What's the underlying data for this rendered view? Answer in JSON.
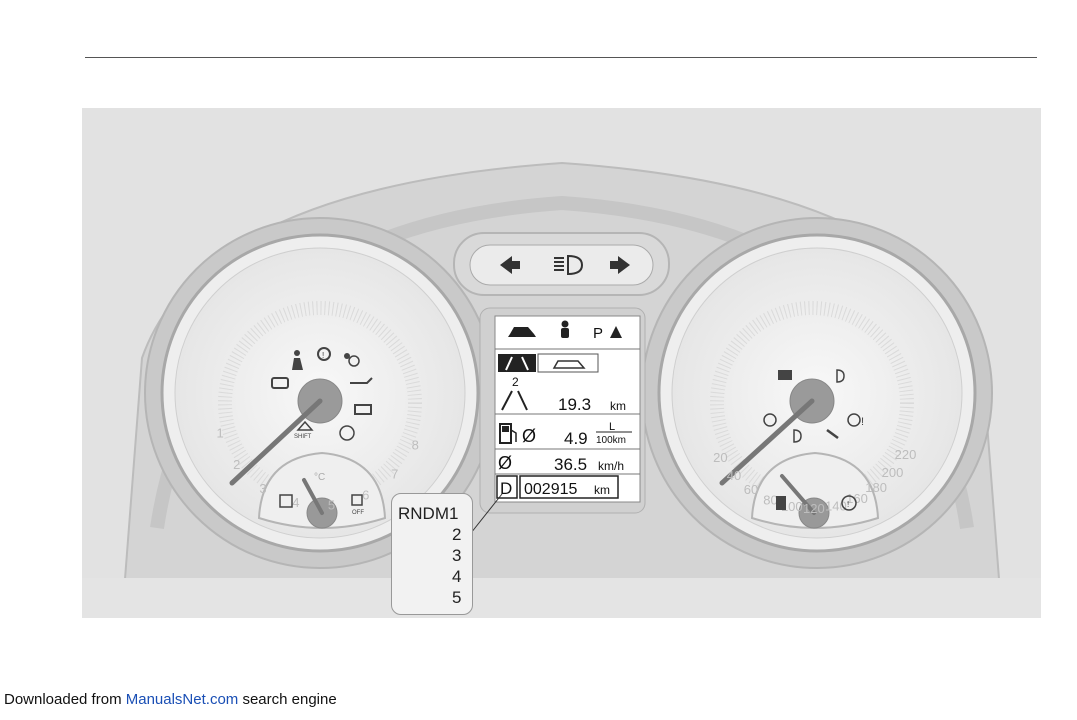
{
  "page": {
    "footer_prefix": "Downloaded from",
    "footer_link": "ManualsNet.com",
    "footer_suffix": "search engine"
  },
  "cluster": {
    "tachometer_ticks": [
      "1",
      "2",
      "3",
      "4",
      "5",
      "6",
      "7",
      "8"
    ],
    "speedometer_ticks": [
      "20",
      "40",
      "60",
      "80",
      "100",
      "120",
      "140",
      "160",
      "180",
      "200",
      "220"
    ],
    "temp_unit": "°C",
    "lcd": {
      "row1_icons": [
        "car-icon",
        "seat-occupant-icon",
        "park-assist-icon"
      ],
      "park_label": "P",
      "trip_number": "2",
      "trip_distance": "19.3",
      "trip_distance_unit": "km",
      "avg_consumption": "4.9",
      "consumption_unit_top": "L",
      "consumption_unit_bottom": "100km",
      "avg_speed": "36.5",
      "avg_speed_unit": "km/h",
      "avg_symbol": "Ø",
      "gear": "D",
      "odometer": "002915",
      "odometer_unit": "km"
    },
    "gear_callout": {
      "first": "RNDM1",
      "others": [
        "2",
        "3",
        "4",
        "5"
      ]
    },
    "shift_label": "SHIFT",
    "off_label": "OFF"
  }
}
